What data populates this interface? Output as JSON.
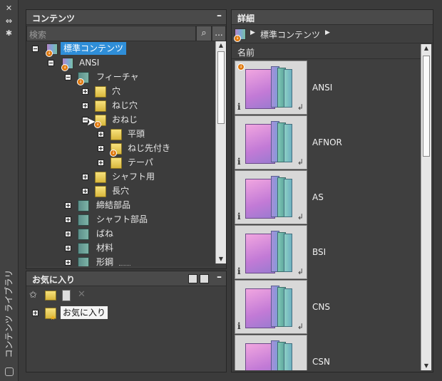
{
  "palette": {
    "title": "コンテンツ ライブラリ"
  },
  "content_panel": {
    "title": "コンテンツ",
    "minimize": "–",
    "search_placeholder": "検索",
    "more": "...",
    "tree": [
      {
        "label": "標準コンテンツ",
        "icon": "library-book-icon",
        "expander": "−",
        "selected": true
      },
      {
        "label": "ANSI",
        "icon": "book-stack-icon",
        "expander": "−"
      },
      {
        "label": "フィーチャ",
        "icon": "teal-book-icon",
        "expander": "−"
      },
      {
        "label": "穴",
        "icon": "folder-icon",
        "expander": "+"
      },
      {
        "label": "ねじ穴",
        "icon": "folder-icon",
        "expander": "+"
      },
      {
        "label": "おねじ",
        "icon": "folder-icon",
        "expander": "−"
      },
      {
        "label": "平頭",
        "icon": "folder-icon",
        "expander": "+"
      },
      {
        "label": "ねじ先付き",
        "icon": "folder-icon",
        "expander": "+"
      },
      {
        "label": "テーパ",
        "icon": "folder-icon",
        "expander": "+"
      },
      {
        "label": "シャフト用",
        "icon": "folder-icon",
        "expander": "+"
      },
      {
        "label": "長穴",
        "icon": "folder-icon",
        "expander": "+"
      },
      {
        "label": "締結部品",
        "icon": "teal-book-icon",
        "expander": "+"
      },
      {
        "label": "シャフト部品",
        "icon": "teal-book-icon",
        "expander": "+"
      },
      {
        "label": "ばね",
        "icon": "teal-book-icon",
        "expander": "+"
      },
      {
        "label": "材料",
        "icon": "teal-book-icon",
        "expander": "+"
      },
      {
        "label": "形鋼",
        "icon": "teal-book-icon",
        "expander": "+"
      }
    ]
  },
  "favorites_panel": {
    "title": "お気に入り",
    "minimize": "–",
    "tree": [
      {
        "label": "お気に入り",
        "expander": "+"
      }
    ]
  },
  "detail_panel": {
    "title": "詳細",
    "breadcrumb": "標準コンテンツ",
    "column_header": "名前",
    "items": [
      {
        "name": "ANSI"
      },
      {
        "name": "AFNOR"
      },
      {
        "name": "AS"
      },
      {
        "name": "BSI"
      },
      {
        "name": "CNS"
      },
      {
        "name": "CSN"
      }
    ]
  }
}
